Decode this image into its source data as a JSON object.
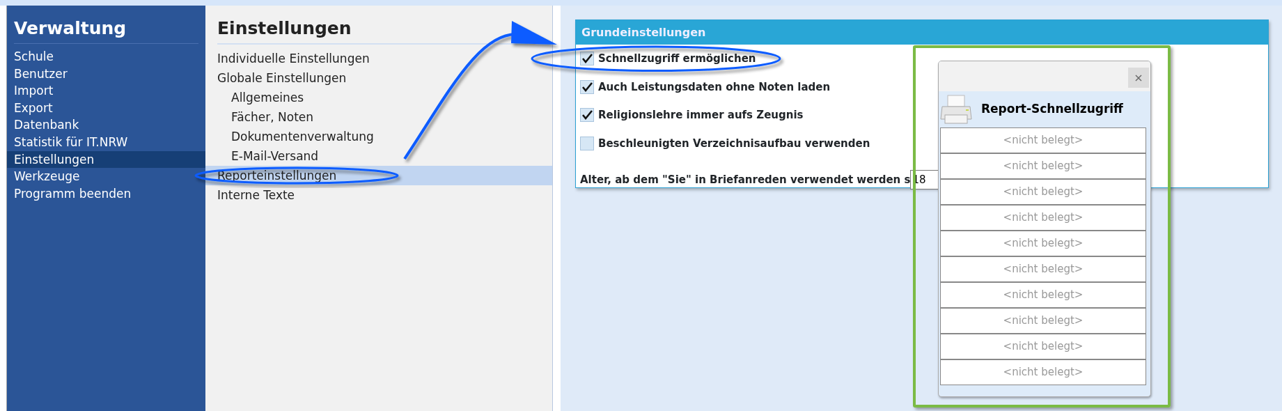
{
  "sidebar": {
    "title": "Verwaltung",
    "items": [
      {
        "label": "Schule",
        "selected": false
      },
      {
        "label": "Benutzer",
        "selected": false
      },
      {
        "label": "Import",
        "selected": false
      },
      {
        "label": "Export",
        "selected": false
      },
      {
        "label": "Datenbank",
        "selected": false
      },
      {
        "label": "Statistik für IT.NRW",
        "selected": false
      },
      {
        "label": "Einstellungen",
        "selected": true
      },
      {
        "label": "Werkzeuge",
        "selected": false
      },
      {
        "label": "Programm beenden",
        "selected": false
      }
    ]
  },
  "settings_menu": {
    "title": "Einstellungen",
    "items": [
      {
        "label": "Individuelle Einstellungen",
        "selected": false
      },
      {
        "label": "Globale Einstellungen",
        "selected": false,
        "children": [
          {
            "label": "Allgemeines",
            "selected": false
          },
          {
            "label": "Fächer, Noten",
            "selected": false
          },
          {
            "label": "Dokumentenverwaltung",
            "selected": false
          },
          {
            "label": "E-Mail-Versand",
            "selected": false
          }
        ]
      },
      {
        "label": "Reporteinstellungen",
        "selected": true
      },
      {
        "label": "Interne Texte",
        "selected": false
      }
    ]
  },
  "group": {
    "title": "Grundeinstellungen",
    "options": [
      {
        "label": "Schnellzugriff ermöglichen",
        "checked": true
      },
      {
        "label": "Auch Leistungsdaten ohne Noten laden",
        "checked": true
      },
      {
        "label": "Religionslehre immer aufs Zeugnis",
        "checked": true
      },
      {
        "label": "Beschleunigten Verzeichnisaufbau verwenden",
        "checked": false
      }
    ],
    "age_field": {
      "label": "Alter, ab dem \"Sie\" in Briefanreden verwendet werden s",
      "value": "18"
    }
  },
  "quick_access": {
    "close": "×",
    "title": "Report-Schnellzugriff",
    "slots": [
      "<nicht belegt>",
      "<nicht belegt>",
      "<nicht belegt>",
      "<nicht belegt>",
      "<nicht belegt>",
      "<nicht belegt>",
      "<nicht belegt>",
      "<nicht belegt>",
      "<nicht belegt>",
      "<nicht belegt>"
    ]
  }
}
